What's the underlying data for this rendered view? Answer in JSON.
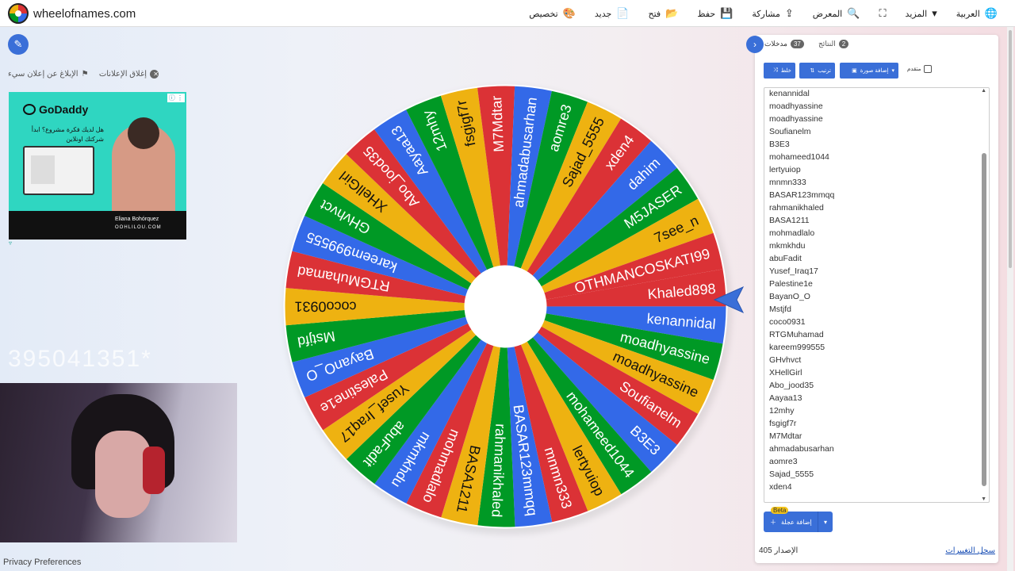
{
  "brand": {
    "name": "wheelofnames.com"
  },
  "menu": [
    {
      "label": "العربية",
      "icon": "globe-icon",
      "glyph": "🌐"
    },
    {
      "label": "المزيد",
      "icon": "caret-down-icon",
      "glyph": "▾"
    },
    {
      "label": "",
      "icon": "fullscreen-icon",
      "glyph": "⛶"
    },
    {
      "label": "المعرض",
      "icon": "search-icon",
      "glyph": "🔍"
    },
    {
      "label": "مشاركة",
      "icon": "share-icon",
      "glyph": "⇪"
    },
    {
      "label": "حفظ",
      "icon": "save-icon",
      "glyph": "💾"
    },
    {
      "label": "فتح",
      "icon": "folder-icon",
      "glyph": "📂"
    },
    {
      "label": "جديد",
      "icon": "file-icon",
      "glyph": "📄"
    },
    {
      "label": "تخصيص",
      "icon": "palette-icon",
      "glyph": "🎨"
    }
  ],
  "ads": {
    "close_ads": "إغلاق الإعلانات",
    "report_ad": "الإبلاغ عن إعلان سيء",
    "brand": "GoDaddy",
    "headline": "هل لديك فكرة مشروع؟ ابدأ شركتك اونلاين",
    "signature": "Eliana Bohórquez",
    "site": "OOHLILOU.COM"
  },
  "ghost_text": "395041351*",
  "privacy": "Privacy Preferences",
  "panel": {
    "tab_entries": "مدخلات",
    "tab_entries_count": "37",
    "tab_results": "النتائج",
    "tab_results_count": "2",
    "shuffle": "خلط",
    "sort": "ترتيب",
    "add_image": "إضافة صورة",
    "advanced": "متقدم",
    "add_wheel": "إضافة عجلة",
    "beta": "Beta",
    "version_label": "الإصدار",
    "version": "405",
    "changelog": "سجل التغييرات"
  },
  "entries_list": [
    "kenannidal",
    "moadhyassine",
    "moadhyassine",
    "Soufianelm",
    "B3E3",
    "mohameed1044",
    "lertyuiop",
    "mnmn333",
    "BASAR123mmqq",
    "rahmanikhaled",
    "BASA1211",
    "mohmadlalo",
    "mkmkhdu",
    "abuFadit",
    "Yusef_Iraq17",
    "Palestine1e",
    "BayanO_O",
    "Mstjfd",
    "coco0931",
    "RTGMuhamad",
    "kareem999555",
    "GHvhvct",
    "XHellGirl",
    "Abo_jood35",
    "Aayaa13",
    "12mhy",
    "fsgigf7r",
    "M7Mdtar",
    "ahmadabusarhan",
    "aomre3",
    "Sajad_5555",
    "xden4"
  ],
  "wheel": {
    "colors": [
      "#db3236",
      "#3369e8",
      "#009925",
      "#eeb211"
    ],
    "rotation_deg": -4.9,
    "segments": [
      "Khaled898",
      "kenannidal",
      "moadhyassine",
      "moadhyassine",
      "Soufianelm",
      "B3E3",
      "mohameed1044",
      "lertyuiop",
      "mnmn333",
      "BASAR123mmqq",
      "rahmanikhaled",
      "BASA1211",
      "mohmadlalo",
      "mkmkhdu",
      "abuFadit",
      "Yusef_Iraq17",
      "Palestine1e",
      "BayanO_O",
      "Mstjfd",
      "coco0931",
      "RTGMuhamad",
      "kareem999555",
      "GHvhvct",
      "XHellGirl",
      "Abo_jood35",
      "Aayaa13",
      "12mhy",
      "fsgigf7r",
      "M7Mdtar",
      "ahmadabusarhan",
      "aomre3",
      "Sajad_5555",
      "xden4",
      "dahim",
      "M5JASER",
      "7see_n",
      "OTHMANCOSKATI99"
    ]
  }
}
